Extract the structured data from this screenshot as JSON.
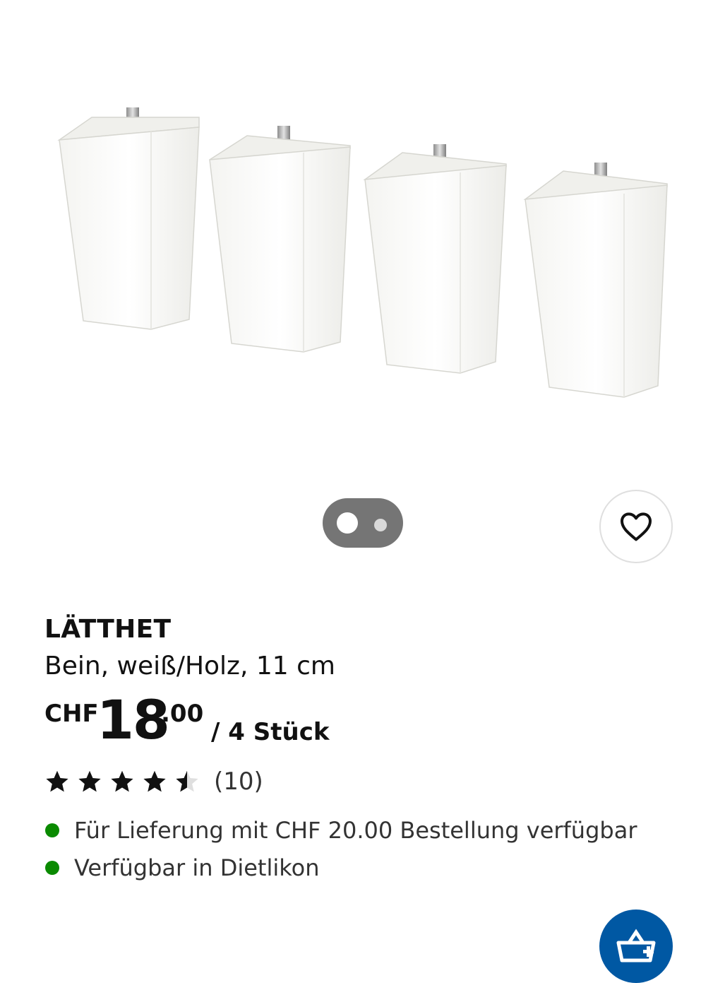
{
  "gallery": {
    "image_alt": "LÄTTHET legs",
    "indicator": {
      "total": 2,
      "active_index": 0
    },
    "favourite_icon": "heart-outline-icon"
  },
  "product": {
    "name": "LÄTTHET",
    "description": "Bein, weiß/Holz, 11 cm",
    "price": {
      "currency": "CHF",
      "integer": "18",
      "decimals": ".00",
      "unit": "/ 4 Stück"
    },
    "rating": {
      "value": 4.5,
      "max": 5,
      "count_label": "(10)"
    },
    "availability": [
      {
        "text": "Für Lieferung mit CHF 20.00 Bestellung verfügbar",
        "status_color": "#0a8a00"
      },
      {
        "text": "Verfügbar in Dietlikon",
        "status_color": "#0a8a00"
      }
    ]
  },
  "cart": {
    "icon": "shopping-bag-add-icon",
    "color": "#0058a3"
  }
}
